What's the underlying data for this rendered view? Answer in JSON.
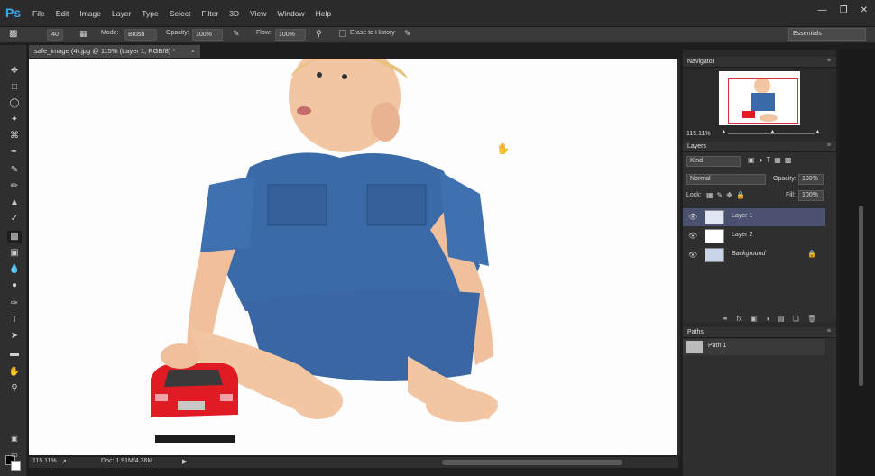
{
  "app": {
    "logo": "Ps"
  },
  "menu": [
    "File",
    "Edit",
    "Image",
    "Layer",
    "Type",
    "Select",
    "Filter",
    "3D",
    "View",
    "Window",
    "Help"
  ],
  "options": {
    "brush_size": "40",
    "mode_label": "Mode:",
    "mode_value": "Brush",
    "opacity_label": "Opacity:",
    "opacity_value": "100%",
    "flow_label": "Flow:",
    "flow_value": "100%",
    "erase_history": "Erase to History",
    "workspace": "Essentials"
  },
  "document": {
    "tab_title": "safe_image (4).jpg @ 115% (Layer 1, RGB/8) *"
  },
  "status": {
    "zoom": "115.11%",
    "doc": "Doc: 1.91M/4.36M"
  },
  "navigator": {
    "title": "Navigator",
    "zoom": "115.11%"
  },
  "layers": {
    "title": "Layers",
    "kind": "Kind",
    "blend": "Normal",
    "opacity_label": "Opacity:",
    "opacity_value": "100%",
    "lock_label": "Lock:",
    "fill_label": "Fill:",
    "fill_value": "100%",
    "items": [
      {
        "name": "Layer 1"
      },
      {
        "name": "Layer 2"
      },
      {
        "name": "Background"
      }
    ]
  },
  "paths": {
    "title": "Paths",
    "items": [
      {
        "name": "Path 1"
      }
    ]
  }
}
